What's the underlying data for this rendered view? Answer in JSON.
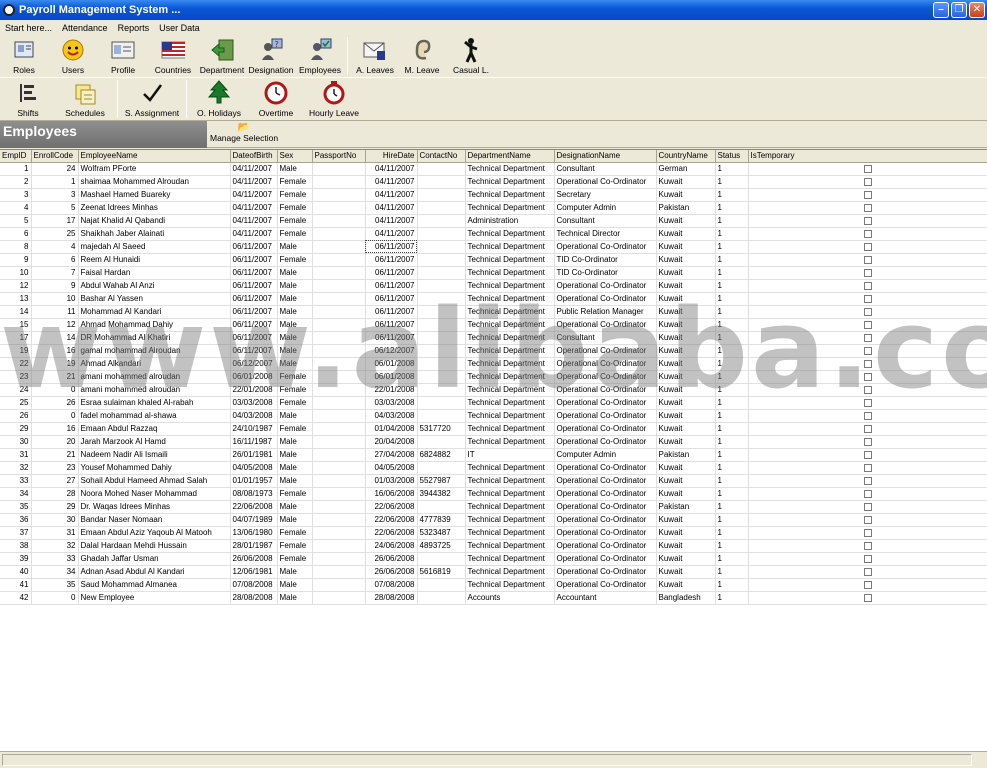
{
  "window": {
    "title": "Payroll Management System ..."
  },
  "menu": [
    "Start here...",
    "Attendance",
    "Reports",
    "User Data"
  ],
  "toolbar1": [
    {
      "label": "Roles",
      "icon": "roles-icon"
    },
    {
      "label": "Users",
      "icon": "users-icon"
    },
    {
      "label": "Profile",
      "icon": "profile-icon"
    },
    {
      "label": "Countries",
      "icon": "countries-icon"
    },
    {
      "label": "Department",
      "icon": "department-icon"
    },
    {
      "label": "Designation",
      "icon": "designation-icon"
    },
    {
      "label": "Employees",
      "icon": "employees-icon"
    },
    {
      "label": "A. Leaves",
      "icon": "annual-leaves-icon"
    },
    {
      "label": "M. Leave",
      "icon": "medical-leave-icon"
    },
    {
      "label": "Casual L.",
      "icon": "casual-leave-icon"
    }
  ],
  "toolbar2": [
    {
      "label": "Shifts",
      "icon": "shifts-icon"
    },
    {
      "label": "Schedules",
      "icon": "schedules-icon"
    },
    {
      "label": "S. Assignment",
      "icon": "checkmark-icon"
    },
    {
      "label": "O. Holidays",
      "icon": "tree-icon"
    },
    {
      "label": "Overtime",
      "icon": "clock-icon"
    },
    {
      "label": "Hourly Leave",
      "icon": "alarm-clock-icon"
    }
  ],
  "section": {
    "title": "Employees",
    "manage_label": "Manage Selection"
  },
  "table": {
    "columns": [
      "EmpID",
      "EnrollCode",
      "EmployeeName",
      "DateofBirth",
      "Sex",
      "PassportNo",
      "HireDate",
      "ContactNo",
      "DepartmentName",
      "DesignationName",
      "CountryName",
      "Status",
      "IsTemporary"
    ],
    "rows": [
      [
        "1",
        "24",
        "Wolfram  PForte",
        "04/11/2007",
        "Male",
        "",
        "04/11/2007",
        "",
        "Technical Department",
        "Consultant",
        "German",
        "1"
      ],
      [
        "2",
        "1",
        "shaimaa  Mohammed  Alroudan",
        "04/11/2007",
        "Female",
        "",
        "04/11/2007",
        "",
        "Technical Department",
        "Operational Co-Ordinator",
        "Kuwait",
        "1"
      ],
      [
        "3",
        "3",
        "Mashael  Hamed  Buareky",
        "04/11/2007",
        "Female",
        "",
        "04/11/2007",
        "",
        "Technical Department",
        "Secretary",
        "Kuwait",
        "1"
      ],
      [
        "4",
        "5",
        "Zeenat  Idrees  Minhas",
        "04/11/2007",
        "Female",
        "",
        "04/11/2007",
        "",
        "Technical Department",
        "Computer Admin",
        "Pakistan",
        "1"
      ],
      [
        "5",
        "17",
        "Najat  Khalid Al Qabandi",
        "04/11/2007",
        "Female",
        "",
        "04/11/2007",
        "",
        "Administration",
        "Consultant",
        "Kuwait",
        "1"
      ],
      [
        "6",
        "25",
        "Shaikhah Jaber Alainati",
        "04/11/2007",
        "Female",
        "",
        "04/11/2007",
        "",
        "Technical Department",
        "Technical Director",
        "Kuwait",
        "1"
      ],
      [
        "8",
        "4",
        "majedah Al Saeed",
        "06/11/2007",
        "Male",
        "",
        "06/11/2007",
        "",
        "Technical Department",
        "Operational Co-Ordinator",
        "Kuwait",
        "1"
      ],
      [
        "9",
        "6",
        "Reem Al Hunaidi",
        "06/11/2007",
        "Female",
        "",
        "06/11/2007",
        "",
        "Technical Department",
        "TID Co-Ordinator",
        "Kuwait",
        "1"
      ],
      [
        "10",
        "7",
        "Faisal Hardan",
        "06/11/2007",
        "Male",
        "",
        "06/11/2007",
        "",
        "Technical Department",
        "TID Co-Ordinator",
        "Kuwait",
        "1"
      ],
      [
        "12",
        "9",
        "Abdul Wahab Al Anzi",
        "06/11/2007",
        "Male",
        "",
        "06/11/2007",
        "",
        "Technical Department",
        "Operational Co-Ordinator",
        "Kuwait",
        "1"
      ],
      [
        "13",
        "10",
        "Bashar  Al Yassen",
        "06/11/2007",
        "Male",
        "",
        "06/11/2007",
        "",
        "Technical Department",
        "Operational Co-Ordinator",
        "Kuwait",
        "1"
      ],
      [
        "14",
        "11",
        "Mohammad Al Kandari",
        "06/11/2007",
        "Male",
        "",
        "06/11/2007",
        "",
        "Technical Department",
        "Public Relation Manager",
        "Kuwait",
        "1"
      ],
      [
        "15",
        "12",
        "Ahmad Mohammad Dahiy",
        "06/11/2007",
        "Male",
        "",
        "06/11/2007",
        "",
        "Technical Department",
        "Operational Co-Ordinator",
        "Kuwait",
        "1"
      ],
      [
        "17",
        "14",
        "DR Mohammad Al Khatiri",
        "06/11/2007",
        "Male",
        "",
        "06/11/2007",
        "",
        "Technical Department",
        "Consultant",
        "Kuwait",
        "1"
      ],
      [
        "19",
        "16",
        "gamal mohammad Alroudan",
        "06/11/2007",
        "Male",
        "",
        "06/12/2007",
        "",
        "Technical Department",
        "Operational Co-Ordinator",
        "Kuwait",
        "1"
      ],
      [
        "22",
        "19",
        "Ahmad Alkandari",
        "06/12/2007",
        "Male",
        "",
        "06/01/2008",
        "",
        "Technical Department",
        "Operational Co-Ordinator",
        "Kuwait",
        "1"
      ],
      [
        "23",
        "21",
        "amani mohammed alroudan",
        "06/01/2008",
        "Female",
        "",
        "06/01/2008",
        "",
        "Technical Department",
        "Operational Co-Ordinator",
        "Kuwait",
        "1"
      ],
      [
        "24",
        "0",
        "amani mohammed alroudan",
        "22/01/2008",
        "Female",
        "",
        "22/01/2008",
        "",
        "Technical Department",
        "Operational Co-Ordinator",
        "Kuwait",
        "1"
      ],
      [
        "25",
        "26",
        "Esraa sulaiman khaled Al-rabah",
        "03/03/2008",
        "Female",
        "",
        "03/03/2008",
        "",
        "Technical Department",
        "Operational Co-Ordinator",
        "Kuwait",
        "1"
      ],
      [
        "26",
        "0",
        "fadel mohammad al-shawa",
        "04/03/2008",
        "Male",
        "",
        "04/03/2008",
        "",
        "Technical Department",
        "Operational Co-Ordinator",
        "Kuwait",
        "1"
      ],
      [
        "29",
        "16",
        "Emaan Abdul Razzaq",
        "24/10/1987",
        "Female",
        "",
        "01/04/2008",
        "5317720",
        "Technical Department",
        "Operational Co-Ordinator",
        "Kuwait",
        "1"
      ],
      [
        "30",
        "20",
        "Jarah Marzook Al Hamd",
        "16/11/1987",
        "Male",
        "",
        "20/04/2008",
        "",
        "Technical Department",
        "Operational Co-Ordinator",
        "Kuwait",
        "1"
      ],
      [
        "31",
        "21",
        "Nadeem Nadir Ali Ismaili",
        "26/01/1981",
        "Male",
        "",
        "27/04/2008",
        "6824882",
        "IT",
        "Computer Admin",
        "Pakistan",
        "1"
      ],
      [
        "32",
        "23",
        "Yousef  Mohammed Dahiy",
        "04/05/2008",
        "Male",
        "",
        "04/05/2008",
        "",
        "Technical Department",
        "Operational Co-Ordinator",
        "Kuwait",
        "1"
      ],
      [
        "33",
        "27",
        "Sohail Abdul Hameed Ahmad Salah",
        "01/01/1957",
        "Male",
        "",
        "01/03/2008",
        "5527987",
        "Technical Department",
        "Operational Co-Ordinator",
        "Kuwait",
        "1"
      ],
      [
        "34",
        "28",
        "Noora  Mohed Naser Mohammad",
        "08/08/1973",
        "Female",
        "",
        "16/06/2008",
        "3944382",
        "Technical Department",
        "Operational Co-Ordinator",
        "Kuwait",
        "1"
      ],
      [
        "35",
        "29",
        "Dr. Waqas Idrees Minhas",
        "22/06/2008",
        "Male",
        "",
        "22/06/2008",
        "",
        "Technical Department",
        "Operational Co-Ordinator",
        "Pakistan",
        "1"
      ],
      [
        "36",
        "30",
        "Bandar Naser Nomaan",
        "04/07/1989",
        "Male",
        "",
        "22/06/2008",
        "4777839",
        "Technical Department",
        "Operational Co-Ordinator",
        "Kuwait",
        "1"
      ],
      [
        "37",
        "31",
        "Emaan Abdul Aziz Yaqoub Al Matooh",
        "13/06/1980",
        "Female",
        "",
        "22/06/2008",
        "5323487",
        "Technical Department",
        "Operational Co-Ordinator",
        "Kuwait",
        "1"
      ],
      [
        "38",
        "32",
        "Dalal Hardaan Mehdi Hussain",
        "28/01/1987",
        "Female",
        "",
        "24/06/2008",
        "4893725",
        "Technical Department",
        "Operational Co-Ordinator",
        "Kuwait",
        "1"
      ],
      [
        "39",
        "33",
        "Ghadah Jaffar Usman",
        "26/06/2008",
        "Female",
        "",
        "26/06/2008",
        "",
        "Technical Department",
        "Operational Co-Ordinator",
        "Kuwait",
        "1"
      ],
      [
        "40",
        "34",
        "Adnan Asad Abdul  Al Kandari",
        "12/06/1981",
        "Male",
        "",
        "26/06/2008",
        "5616819",
        "Technical Department",
        "Operational Co-Ordinator",
        "Kuwait",
        "1"
      ],
      [
        "41",
        "35",
        "Saud Mohammad Almanea",
        "07/08/2008",
        "Male",
        "",
        "07/08/2008",
        "",
        "Technical Department",
        "Operational Co-Ordinator",
        "Kuwait",
        "1"
      ],
      [
        "42",
        "0",
        "New Employee",
        "28/08/2008",
        "Male",
        "",
        "28/08/2008",
        "",
        "Accounts",
        "Accountant",
        "Bangladesh",
        "1"
      ]
    ]
  },
  "watermark": "www.alibaba.com"
}
